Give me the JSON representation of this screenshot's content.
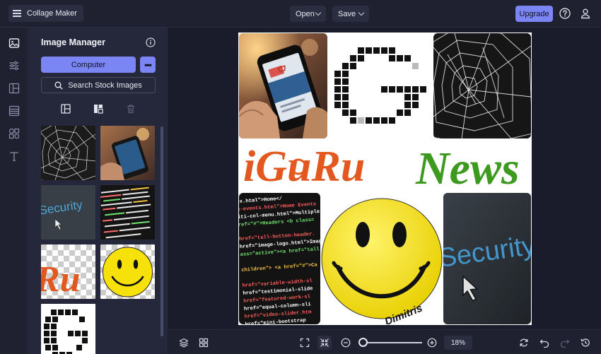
{
  "topbar": {
    "brand_label": "Collage Maker",
    "open_label": "Open",
    "save_label": "Save",
    "upgrade_label": "Upgrade"
  },
  "panel": {
    "title": "Image Manager",
    "computer_label": "Computer",
    "more_label": "•••",
    "stock_label": "Search Stock Images"
  },
  "rail": {
    "icons": [
      "image-icon",
      "sliders-icon",
      "layout-icon",
      "stripes-icon",
      "shapes-icon",
      "text-icon"
    ]
  },
  "collage": {
    "logo_text": "iGuRu News",
    "smiley_signature": "Dimitris",
    "security_text": "Security",
    "code_lines": [
      ".html\">Home</",
      "events.html\">Home Events",
      "lti-col-menu.html\">Multiple",
      "ref=\"#\">Headers <b class=",
      "",
      "href=\"tall-button-header.h",
      "href=\"image-logo.html\">Imag",
      "ass=\"active\"><a href=\"tall-",
      "",
      "children\"> <a href=\"#\">Ca",
      "",
      "href=\"variable-width-sl",
      "href=\"testimonial-slide",
      "href=\"featured-work-sl",
      "href=\"equal-column-sli",
      "href=\"video-slider.htm",
      "href=\"mini-bootstrap"
    ]
  },
  "bottombar": {
    "zoom": "18%",
    "zoom_value": 18
  },
  "colors": {
    "accent": "#7b86f4",
    "background": "#1e2030",
    "panel": "#25283a"
  }
}
